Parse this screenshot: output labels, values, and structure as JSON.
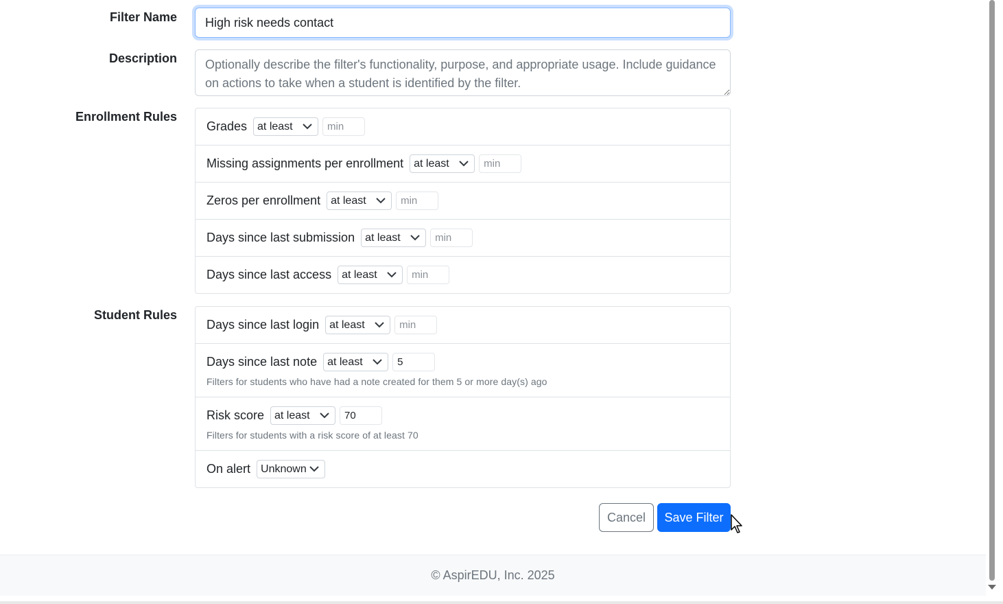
{
  "form": {
    "filter_name_label": "Filter Name",
    "filter_name_value": "High risk needs contact",
    "description_label": "Description",
    "description_placeholder": "Optionally describe the filter's functionality, purpose, and appropriate usage. Include guidance on actions to take when a student is identified by the filter.",
    "enrollment_rules_label": "Enrollment Rules",
    "student_rules_label": "Student Rules",
    "enrollment_rules": [
      {
        "name": "Grades",
        "operator": "at least",
        "value": "min"
      },
      {
        "name": "Missing assignments per enrollment",
        "operator": "at least",
        "value": "min"
      },
      {
        "name": "Zeros per enrollment",
        "operator": "at least",
        "value": "min"
      },
      {
        "name": "Days since last submission",
        "operator": "at least",
        "value": "min"
      },
      {
        "name": "Days since last access",
        "operator": "at least",
        "value": "min"
      }
    ],
    "student_rules": [
      {
        "name": "Days since last login",
        "operator": "at least",
        "value": "min"
      },
      {
        "name": "Days since last note",
        "operator": "at least",
        "value": "5",
        "help": "Filters for students who have had a note created for them 5 or more day(s) ago"
      },
      {
        "name": "Risk score",
        "operator": "at least",
        "value": "70",
        "help": "Filters for students with a risk score of at least 70"
      },
      {
        "name": "On alert",
        "select_value": "Unknown"
      }
    ],
    "cancel_label": "Cancel",
    "save_label": "Save Filter"
  },
  "footer": {
    "copyright": "© AspirEDU, Inc. 2025"
  },
  "colors": {
    "primary": "#0d6efd",
    "secondary": "#6c757d",
    "border": "#dee2e6",
    "footer_bg": "#f8f9fa"
  },
  "icons": {
    "select_arrow": "chevron-down-icon",
    "pointer": "cursor-arrow-icon"
  }
}
